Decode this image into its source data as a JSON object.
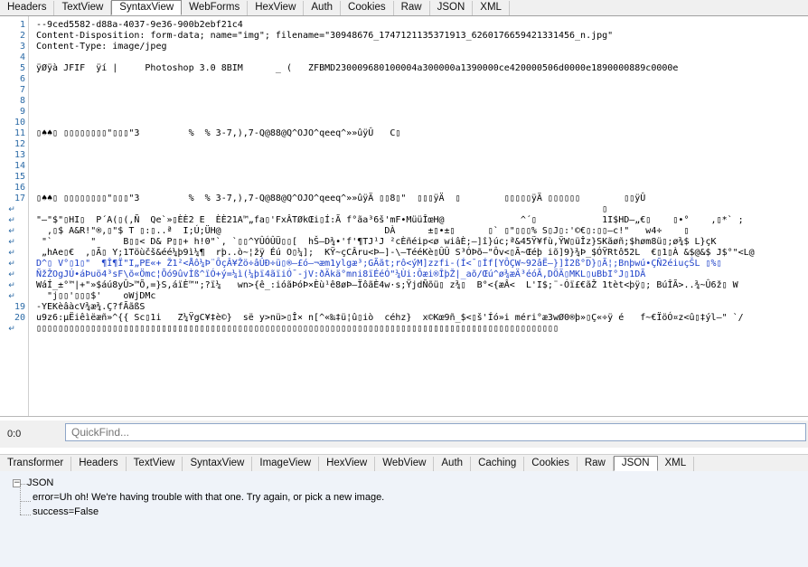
{
  "top_tabs": [
    "Headers",
    "TextView",
    "SyntaxView",
    "WebForms",
    "HexView",
    "Auth",
    "Cookies",
    "Raw",
    "JSON",
    "XML"
  ],
  "top_active": "SyntaxView",
  "editor_lines": [
    {
      "ln": "1",
      "text": "--9ced5582-d88a-4037-9e36-900b2ebf21c4"
    },
    {
      "ln": "2",
      "text": "Content-Disposition: form-data; name=\"img\"; filename=\"30948676_1747121135371913_6260176659421331456_n.jpg\""
    },
    {
      "ln": "3",
      "text": "Content-Type: image/jpeg"
    },
    {
      "ln": "4",
      "text": ""
    },
    {
      "ln": "5",
      "text": "ÿØÿà JFIF  ÿí |     Photoshop 3.0 8BIM      _ (   ZFBMD230009680100004a300000a1390000ce420000506d0000e1890000889c0000e"
    },
    {
      "ln": "6",
      "text": ""
    },
    {
      "ln": "7",
      "text": ""
    },
    {
      "ln": "8",
      "text": ""
    },
    {
      "ln": "9",
      "text": ""
    },
    {
      "ln": "10",
      "text": ""
    },
    {
      "ln": "11",
      "text": "▯♠♠▯ ▯▯▯▯▯▯▯▯\"▯▯▯\"3         %  % 3-7,),7-Q@88@Q^OJO^qeeq^»»ûÿÛ   C▯"
    },
    {
      "ln": "12",
      "text": ""
    },
    {
      "ln": "13",
      "text": ""
    },
    {
      "ln": "14",
      "text": ""
    },
    {
      "ln": "15",
      "text": ""
    },
    {
      "ln": "16",
      "text": ""
    },
    {
      "ln": "17",
      "text": "▯♠♠▯ ▯▯▯▯▯▯▯▯\"▯▯▯\"3         %  % 3-7,),7-Q@88@Q^OJO^qeeq^»»ûÿÄ ▯▯8▯\"  ▯▯▯ÿÄ  ▯        ▯▯▯▯▯ÿÄ ▯▯▯▯▯▯        ▯▯ÿÛ"
    },
    {
      "ln": "",
      "text": "                                                                                                        ▯"
    },
    {
      "ln": "",
      "text": "\"–\"$\"▯HI▯  P´A(▯(,Ñ  Qe`»▯ÈÈ2 E  ÈÈ21A™„fa▯'FxÂTØkŒi▯Í:Ã f°ãa³6š'mF•MüüÎœH@              ^´▯            1I$HD–„€▯    ▯•°    ,▯*` ;"
    },
    {
      "ln": "",
      "text": "  ,▯$ A&R!\"®,▯\"$ T ▯:▯..ª  I;Ú;ÜH@                              DÀ      ±▯•±▯      ▯` ▯\"▯▯▯% S▯J▯:'©€▯:▯▯–c!\"   w4÷    ▯"
    },
    {
      "ln": "",
      "text": " \"`       \"     B▯▯< D& P▯▯+ h!0\"`, `▯▯^YÛÓÛÜ▯▯[  hŠ–D¾•'f'¶TJ¹J ²cÈñéip<ø wiâÈ;–]î}úc;ª&45Ÿ¥fù,ŸW▯üÎz}SKãøñ;$høm8ü▯;ø¾$ L}çK"
    },
    {
      "ln": "",
      "text": " „hAe▯€  ,▯Ã▯ Y;1Töùčš&éé¼þ9ì¼¶  rþ..ò~¦žÿ Éú O▯¼];  KŸ~çCÂru<Þ–]-\\—TééKè▯ÛÛ S³ÓÞõ—\"Ôv<▯Ã~Œéþ iõ]9}¾Þ_$ÓŸRtô52L  €▯1▯À &$@&$ J$°\"<L@"
    },
    {
      "ln": "",
      "text": "D^▯ V°▯1▯\"  ¶Î¶Ï\"I„PE«+ Ž1²<Åô¼Þ¨ÔçÂ¥Žö÷âÛÐ÷ü▯®–£ó–¬æm1ylgæ³;GÃãt;rô<ýM]zzfi-(Í<¯▯Íf[YÔÇW~92âË–}]Ì2ß°D}▯Ã¦;Bnþwú•ÇÑ2éiuçŠL ▯%▯"
    },
    {
      "ln": "",
      "text": "ÑžŽOgJÚ•áÞuö4³sF\\õ«Ömc¦Õó9ûvÌß^ïÓ+ý=¼ì(¼þï4ãïiÓ¯-jV:ðÄkä°mni8ïÉéÓ\"¼Ùi:Ôæi®ÎþŽ|_aõ/Œú^ø¾æÄ³éóÃ,DÖÄ▯MKL▯uBbI°J▯1DÃ"
    },
    {
      "ln": "",
      "text": "WáÍ_±°™|+\"»$áú8yÛ>™Õ,=}S,áïÈ™\";?ï¼   wn>{ê_:ióãÞóÞ×Èù¹ê8øÞ—ÏôãÈ4w·s;ŸjdÑõü▯ z¾▯  B°<{æÂ<  L'I$;¨-Óï£€ãŽ 1tèt<þÿ▯; BúÎÃ>..¾~Û6ž▯ W"
    },
    {
      "ln": "",
      "text": "  \"j▯▯'▯▯▯$'    oWjDMc"
    },
    {
      "ln": "19",
      "text": "-YEKèâàcV¾æ¾.Ç?fÃãßS"
    },
    {
      "ln": "20",
      "text": "u9z6:µËiêìëæñ»^{{ Sc▯1i   Z¼ŸgC¥‡è©}  së y>nü>▯Î× n[^«‰‡ü¦û▯iò  céhz}  x©Kœ9ñ_$<▯š'Íó»i méri°æ3wØ0®þ»▯Ç«÷ÿ é   f~€ÏöÓ¤z<û▯‡ýl–\" `/"
    },
    {
      "ln": "",
      "text": "▯▯▯▯▯▯▯▯▯▯▯▯▯▯▯▯▯▯▯▯▯▯▯▯▯▯▯▯▯▯▯▯▯▯▯▯▯▯▯▯▯▯▯▯▯▯▯▯▯▯▯▯▯▯▯▯▯▯▯▯▯▯▯▯▯▯▯▯▯▯▯▯▯▯▯▯▯▯▯▯▯▯▯▯▯▯▯▯▯▯▯▯▯▯▯▯"
    }
  ],
  "status": {
    "position": "0:0",
    "quickfind_placeholder": "QuickFind..."
  },
  "bottom_tabs": [
    "Transformer",
    "Headers",
    "TextView",
    "SyntaxView",
    "ImageView",
    "HexView",
    "WebView",
    "Auth",
    "Caching",
    "Cookies",
    "Raw",
    "JSON",
    "XML"
  ],
  "bottom_active": "JSON",
  "tree": {
    "root_label": "JSON",
    "children": [
      "error=Uh oh! We're having trouble with that one. Try again, or pick a new image.",
      "success=False"
    ]
  },
  "colors": {
    "line_number": "#2b6aa6",
    "text_blue": "#1a3ec8",
    "text_red": "#c80000",
    "tree_bg": "#eff3f9"
  },
  "icons": {
    "wrap": "wrap-continuation-icon",
    "tree_toggle": "minus-toggle-icon"
  }
}
